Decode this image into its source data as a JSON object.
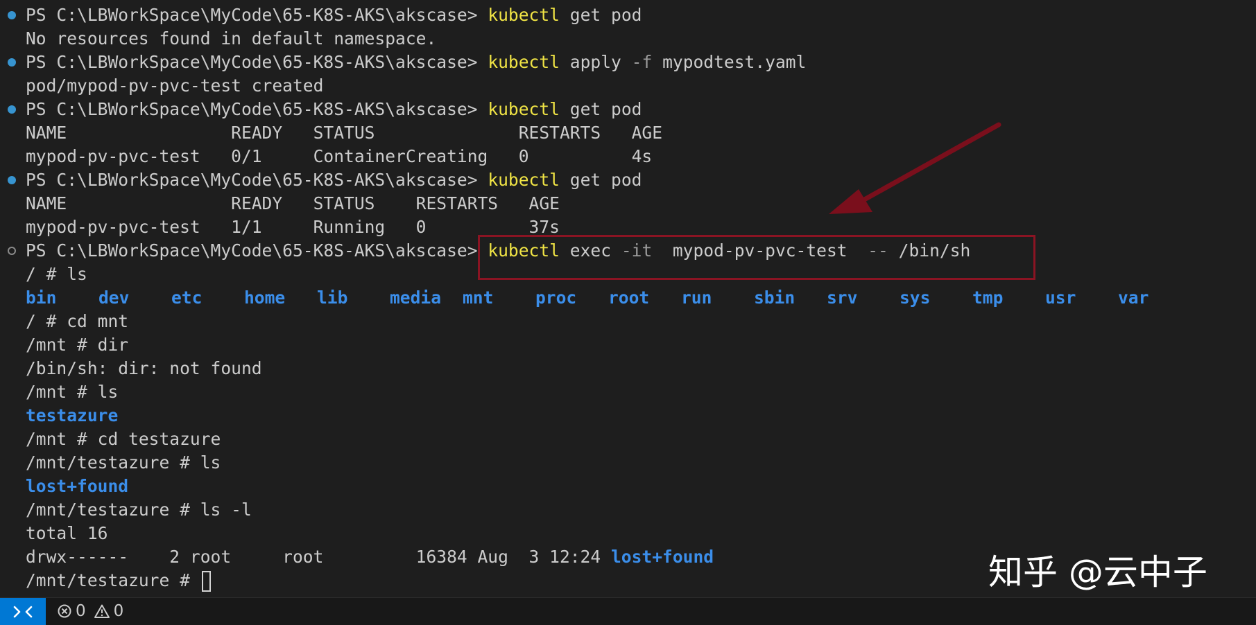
{
  "colors": {
    "background": "#1e1e1e",
    "text": "#cccccc",
    "command": "#f0e445",
    "flag": "#9b9b9b",
    "directory": "#3b8eea",
    "decoration_success": "#3794d0",
    "highlight": "#8b1423",
    "statusbar": "#181818",
    "remote_button": "#0078d4"
  },
  "terminal": {
    "prompt": "PS C:\\LBWorkSpace\\MyCode\\65-K8S-AKS\\akscase>",
    "block1": {
      "cmd": "kubectl",
      "args": "get pod",
      "output": "No resources found in default namespace."
    },
    "block2": {
      "cmd": "kubectl",
      "args1": "apply",
      "flag": "-f",
      "args2": "mypodtest.yaml",
      "output": "pod/mypod-pv-pvc-test created"
    },
    "block3": {
      "cmd": "kubectl",
      "args": "get pod",
      "header": "NAME                READY   STATUS              RESTARTS   AGE",
      "row": "mypod-pv-pvc-test   0/1     ContainerCreating   0          4s"
    },
    "block4": {
      "cmd": "kubectl",
      "args": "get pod",
      "header": "NAME                READY   STATUS    RESTARTS   AGE",
      "row": "mypod-pv-pvc-test   1/1     Running   0          37s"
    },
    "block5": {
      "cmd": "kubectl",
      "args1": "exec",
      "flag": "-it",
      "args2": "mypod-pv-pvc-test",
      "flag2": "--",
      "args3": "/bin/sh"
    },
    "shell": {
      "line1": "/ # ls",
      "ls_root": [
        "bin",
        "dev",
        "etc",
        "home",
        "lib",
        "media",
        "mnt",
        "proc",
        "root",
        "run",
        "sbin",
        "srv",
        "sys",
        "tmp",
        "usr",
        "var"
      ],
      "line2": "/ # cd mnt",
      "line3": "/mnt # dir",
      "line4": "/bin/sh: dir: not found",
      "line5": "/mnt # ls",
      "ls_mnt": "testazure",
      "line6": "/mnt # cd testazure",
      "line7": "/mnt/testazure # ls",
      "ls_testazure": "lost+found",
      "line8": "/mnt/testazure # ls -l",
      "line9": "total 16",
      "ls_long_prefix": "drwx------    2 root     root         16384 Aug  3 12:24",
      "ls_long_name": "lost+found",
      "line10": "/mnt/testazure #"
    }
  },
  "watermark": "知乎 @云中子",
  "statusbar": {
    "errors": "0",
    "warnings": "0",
    "remote_icon": "remote-icon",
    "error_icon": "error-icon",
    "warning_icon": "warning-icon"
  }
}
